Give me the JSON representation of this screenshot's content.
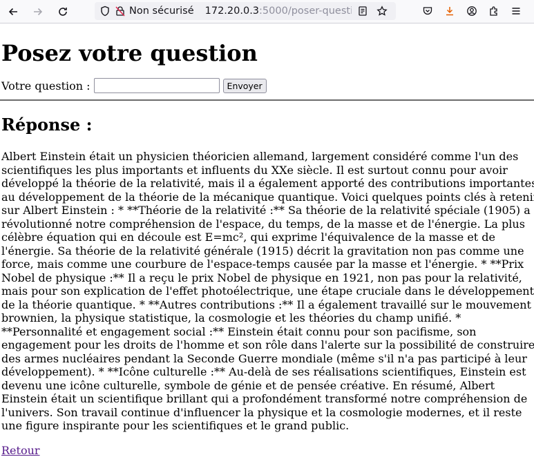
{
  "browser": {
    "security_label": "Non sécurisé",
    "url_host": "172.20.0.3",
    "url_path": ":5000/poser-questio"
  },
  "page": {
    "title": "Posez votre question",
    "question_label": "Votre question :",
    "question_value": "",
    "submit_label": "Envoyer",
    "answer_heading": "Réponse :",
    "answer_text": "Albert Einstein était un physicien théoricien allemand, largement considéré comme l'un des scientifiques les plus importants et influents du XXe siècle. Il est surtout connu pour avoir développé la théorie de la relativité, mais il a également apporté des contributions importantes au développement de la théorie de la mécanique quantique. Voici quelques points clés à retenir sur Albert Einstein : * **Théorie de la relativité :** Sa théorie de la relativité spéciale (1905) a révolutionné notre compréhension de l'espace, du temps, de la masse et de l'énergie. La plus célèbre équation qui en découle est E=mc², qui exprime l'équivalence de la masse et de l'énergie. Sa théorie de la relativité générale (1915) décrit la gravitation non pas comme une force, mais comme une courbure de l'espace-temps causée par la masse et l'énergie. * **Prix Nobel de physique :** Il a reçu le prix Nobel de physique en 1921, non pas pour la relativité, mais pour son explication de l'effet photoélectrique, une étape cruciale dans le développement de la théorie quantique. * **Autres contributions :** Il a également travaillé sur le mouvement brownien, la physique statistique, la cosmologie et les théories du champ unifié. * **Personnalité et engagement social :** Einstein était connu pour son pacifisme, son engagement pour les droits de l'homme et son rôle dans l'alerte sur la possibilité de construire des armes nucléaires pendant la Seconde Guerre mondiale (même s'il n'a pas participé à leur développement). * **Icône culturelle :** Au-delà de ses réalisations scientifiques, Einstein est devenu une icône culturelle, symbole de génie et de pensée créative. En résumé, Albert Einstein était un scientifique brillant qui a profondément transformé notre compréhension de l'univers. Son travail continue d'influencer la physique et la cosmologie modernes, et il reste une figure inspirante pour les scientifiques et le grand public.",
    "back_link": "Retour"
  }
}
